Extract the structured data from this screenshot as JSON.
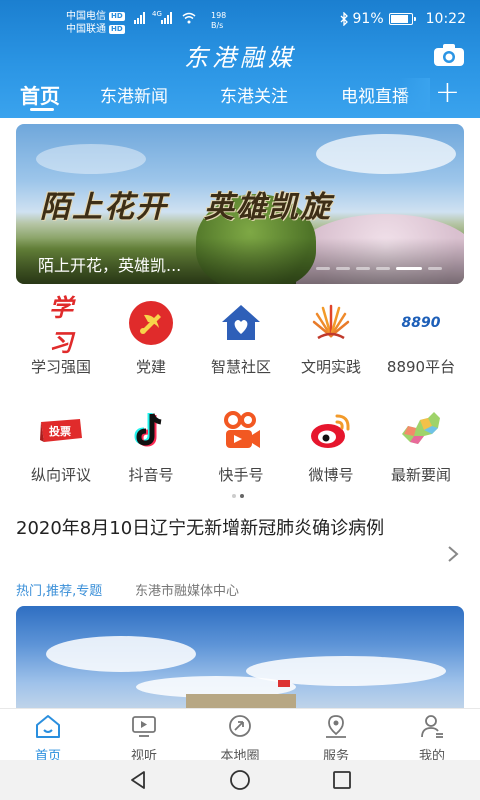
{
  "status_bar": {
    "carrier_1": "中国电信",
    "carrier_2": "中国联通",
    "hd_badge": "HD",
    "net_type": "4G",
    "net_speed_value": "198",
    "net_speed_unit": "B/s",
    "battery": "91%",
    "battery_level": 0.91,
    "time": "10:22"
  },
  "header": {
    "app_title": "东港融媒",
    "tabs": [
      {
        "label": "首页",
        "active": true
      },
      {
        "label": "东港新闻"
      },
      {
        "label": "东港关注"
      },
      {
        "label": "电视直播"
      }
    ],
    "plus_label": "+"
  },
  "banner": {
    "calligraphy_left": "陌上花开",
    "calligraphy_right": "英雄凯旋",
    "caption": "陌上开花，英雄凯..."
  },
  "grid": {
    "items": [
      {
        "label": "学习强国",
        "icon": "xuexi-qiangguo-icon"
      },
      {
        "label": "党建",
        "icon": "party-emblem-icon"
      },
      {
        "label": "智慧社区",
        "icon": "home-community-icon"
      },
      {
        "label": "文明实践",
        "icon": "civilization-practice-icon"
      },
      {
        "label": "8890平台",
        "icon": "8890-platform-icon"
      },
      {
        "label": "纵向评议",
        "icon": "vote-ticket-icon"
      },
      {
        "label": "抖音号",
        "icon": "douyin-icon"
      },
      {
        "label": "快手号",
        "icon": "kuaishou-icon"
      },
      {
        "label": "微博号",
        "icon": "weibo-icon"
      },
      {
        "label": "最新要闻",
        "icon": "map-liaoning-icon"
      }
    ],
    "text": {
      "xuexi": "学习",
      "vote": "投票",
      "num8890": "8890"
    }
  },
  "article": {
    "title": "2020年8月10日辽宁无新增新冠肺炎确诊病例",
    "tags": "热门,推荐,专题",
    "source": "东港市融媒体中心"
  },
  "bottom_nav": {
    "items": [
      {
        "label": "首页",
        "icon": "home-icon",
        "active": true
      },
      {
        "label": "视听",
        "icon": "tv-icon"
      },
      {
        "label": "本地圈",
        "icon": "local-circle-icon"
      },
      {
        "label": "服务",
        "icon": "location-service-icon"
      },
      {
        "label": "我的",
        "icon": "user-profile-icon"
      }
    ]
  },
  "colors": {
    "header_blue": "#2b95e4",
    "accent_blue": "#2b8fde",
    "party_red": "#e02b2b",
    "tag_blue": "#3a8fd8"
  }
}
